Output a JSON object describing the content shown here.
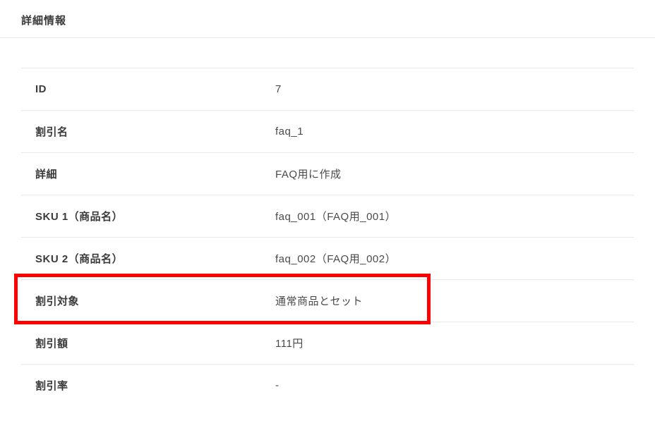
{
  "title": "詳細情報",
  "rows": [
    {
      "label": "ID",
      "value": "7"
    },
    {
      "label": "割引名",
      "value": "faq_1"
    },
    {
      "label": "詳細",
      "value": "FAQ用に作成"
    },
    {
      "label": "SKU 1（商品名）",
      "value": "faq_001（FAQ用_001）"
    },
    {
      "label": "SKU 2（商品名）",
      "value": "faq_002（FAQ用_002）"
    },
    {
      "label": "割引対象",
      "value": "通常商品とセット"
    },
    {
      "label": "割引額",
      "value": "111円"
    },
    {
      "label": "割引率",
      "value": "-"
    }
  ],
  "highlight_row_index": 5
}
